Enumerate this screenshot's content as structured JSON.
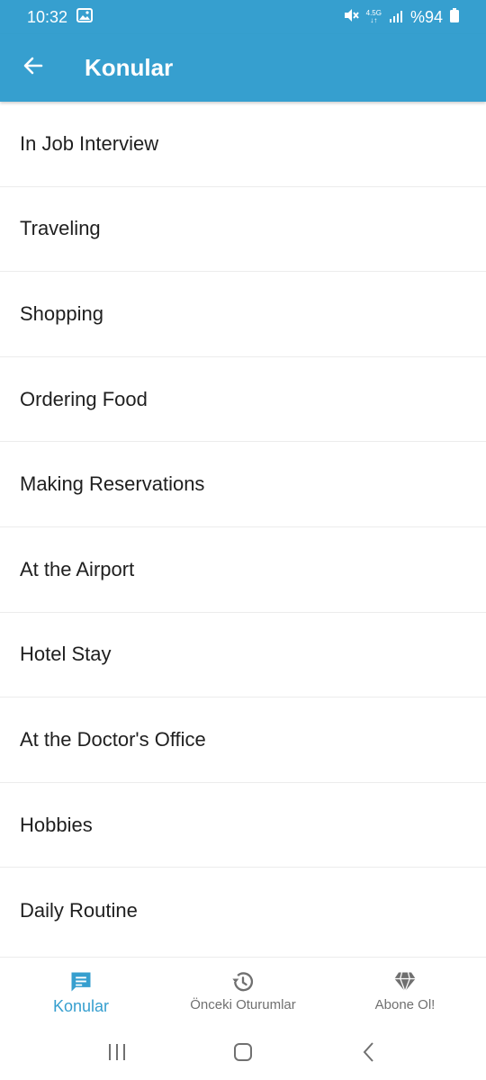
{
  "status_bar": {
    "time": "10:32",
    "network_top": "4.5G",
    "network_bottom": "↓↑",
    "battery": "%94"
  },
  "app_bar": {
    "title": "Konular"
  },
  "topics": [
    "In Job Interview",
    "Traveling",
    "Shopping",
    "Ordering Food",
    "Making Reservations",
    "At the Airport",
    "Hotel Stay",
    "At the Doctor's Office",
    "Hobbies",
    "Daily Routine"
  ],
  "bottom_nav": {
    "tabs": [
      {
        "label": "Konular",
        "icon": "chat-icon",
        "active": true
      },
      {
        "label": "Önceki Oturumlar",
        "icon": "history-icon",
        "active": false
      },
      {
        "label": "Abone Ol!",
        "icon": "diamond-icon",
        "active": false
      }
    ]
  },
  "colors": {
    "primary": "#369fcf",
    "text": "#1f1f1f",
    "inactive": "#707070",
    "divider": "#ececec"
  }
}
